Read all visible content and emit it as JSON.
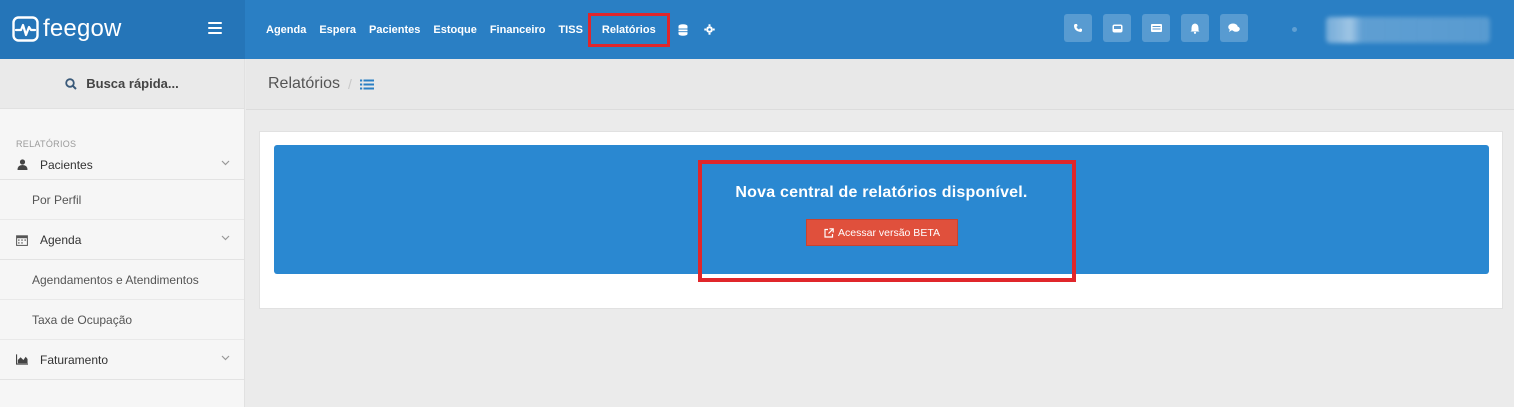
{
  "brand": {
    "name": "feegow"
  },
  "nav": {
    "items": [
      "Agenda",
      "Espera",
      "Pacientes",
      "Estoque",
      "Financeiro",
      "TISS",
      "Relatórios"
    ],
    "active": "Relatórios",
    "extra_icons": [
      "database-icon",
      "gear-icon"
    ]
  },
  "top_actions": [
    "phone-icon",
    "inbox-icon",
    "card-icon",
    "bell-icon",
    "chat-icon"
  ],
  "search": {
    "label": "Busca rápida..."
  },
  "sidebar": {
    "section_title": "RELATÓRIOS",
    "groups": [
      {
        "label": "Pacientes",
        "icon": "user-icon",
        "items": [
          "Por Perfil"
        ]
      },
      {
        "label": "Agenda",
        "icon": "calendar-icon",
        "items": [
          "Agendamentos e Atendimentos",
          "Taxa de Ocupação"
        ]
      },
      {
        "label": "Faturamento",
        "icon": "area-chart-icon",
        "items": []
      }
    ]
  },
  "breadcrumb": {
    "title": "Relatórios",
    "separator": "/"
  },
  "banner": {
    "title": "Nova central de relatórios disponível.",
    "button_label": "Acessar versão BETA"
  },
  "colors": {
    "topbar": "#2a7fc4",
    "banner": "#2a88d1",
    "button": "#e0503c",
    "highlight": "#e0262b"
  }
}
